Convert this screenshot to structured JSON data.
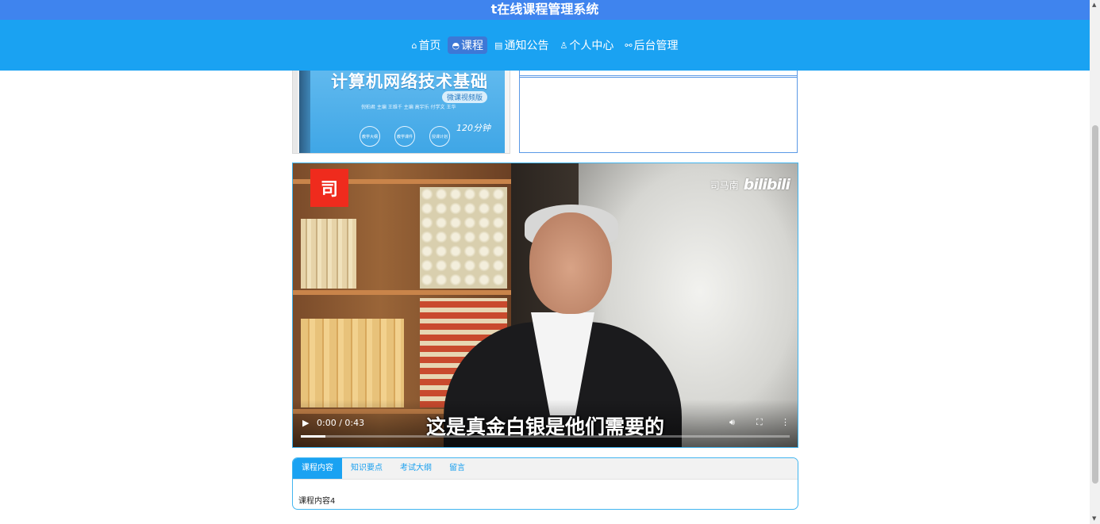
{
  "app": {
    "title": "t在线课程管理系统"
  },
  "nav": {
    "items": [
      {
        "icon": "home-icon",
        "glyph": "⌂",
        "label": "首页"
      },
      {
        "icon": "course-icon",
        "glyph": "◓",
        "label": "课程"
      },
      {
        "icon": "notice-icon",
        "glyph": "▤",
        "label": "通知公告"
      },
      {
        "icon": "user-icon",
        "glyph": "♙",
        "label": "个人中心"
      },
      {
        "icon": "link-icon",
        "glyph": "⚯",
        "label": "后台管理"
      }
    ],
    "active": "课程"
  },
  "book": {
    "title": "计算机网络技术基础",
    "tag": "微课视频版",
    "authors": "倪柏君 主编  王维千  主编   高宇乐  付学文  王华",
    "circles": [
      "教学大纲",
      "教学课件",
      "授课计划"
    ],
    "badge": "120分钟"
  },
  "video": {
    "channel_logo": "司",
    "watermark_name": "司马南",
    "watermark_brand": "bilibili",
    "subtitle": "这是真金白银是他们需要的",
    "time": "0:00 / 0:43",
    "progress": 0.05
  },
  "tabs": {
    "items": [
      "课程内容",
      "知识要点",
      "考试大纲",
      "留言"
    ],
    "active": "课程内容",
    "content": "课程内容4"
  },
  "colors": {
    "title_bar": "#3f84ee",
    "nav_bar": "#1aa2f2",
    "nav_active": "#3d78d6",
    "accent_border": "#41b5f0"
  }
}
